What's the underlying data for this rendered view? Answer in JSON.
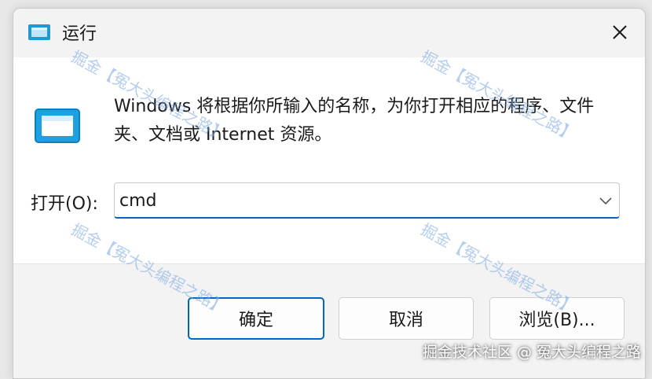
{
  "window": {
    "title": "运行",
    "close_icon": "close-icon",
    "app_icon": "run-icon"
  },
  "content": {
    "description": "Windows 将根据你所输入的名称，为你打开相应的程序、文件夹、文档或 Internet 资源。",
    "open_label": "打开(O):",
    "command_value": "cmd",
    "dropdown_icon": "chevron-down-icon"
  },
  "buttons": {
    "ok": "确定",
    "cancel": "取消",
    "browse": "浏览(B)..."
  },
  "watermarks": {
    "text": "掘金【冤大头编程之路】",
    "credit": "掘金技术社区 @ 冤大头编程之路"
  },
  "colors": {
    "accent": "#0067c0",
    "dialog_bg": "#f3f3f3",
    "content_bg": "#ffffff"
  }
}
